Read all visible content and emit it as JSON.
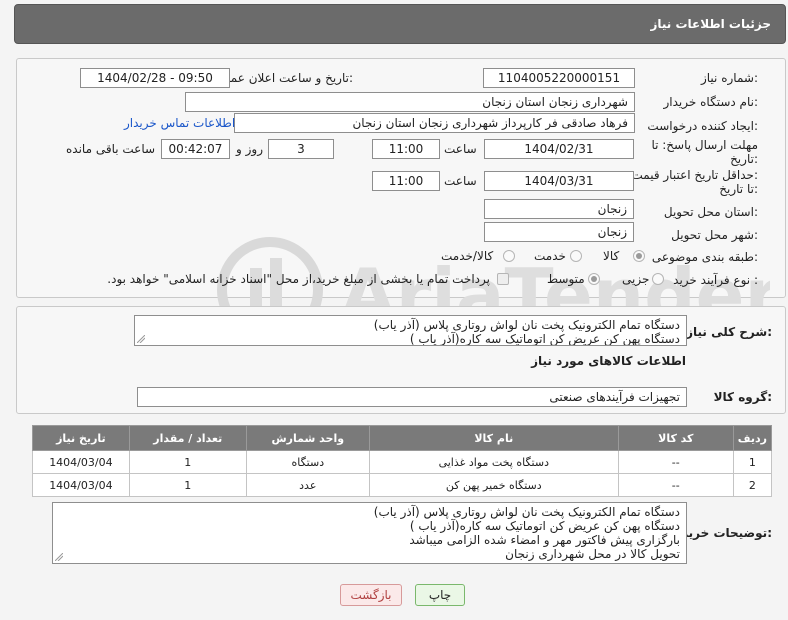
{
  "header": {
    "title": "جزئیات اطلاعات نیاز"
  },
  "form": {
    "need_number_label": "شماره نیاز:",
    "need_number": "1104005220000151",
    "announce_label": "تاریخ و ساعت اعلان عمومی:",
    "announce_value": "1404/02/28 - 09:50",
    "buyer_label": "نام دستگاه خریدار:",
    "buyer_value": "شهرداری زنجان استان زنجان",
    "creator_label": "ایجاد کننده درخواست:",
    "creator_value": "فرهاد صادقی فر کارپرداز شهرداری زنجان استان زنجان",
    "contact_link": "اطلاعات تماس خریدار",
    "deadline_label_1": "مهلت ارسال پاسخ: تا",
    "deadline_label_2": "تاریخ:",
    "deadline_date": "1404/02/31",
    "time_label": "ساعت",
    "deadline_time": "11:00",
    "days_value": "3",
    "days_label": "روز و",
    "remaining_time": "00:42:07",
    "remaining_label": "ساعت باقی مانده",
    "validity_label_1": "حداقل تاریخ اعتبار قیمت:",
    "validity_label_2": "تا تاریخ:",
    "validity_date": "1404/03/31",
    "validity_time": "11:00",
    "province_label": "استان محل تحویل:",
    "province_value": "زنجان",
    "city_label": "شهر محل تحویل:",
    "city_value": "زنجان",
    "category_label": "طبقه بندی موضوعی:",
    "category_options": [
      "کالا",
      "خدمت",
      "کالا/خدمت"
    ],
    "process_label": "نوع فرآیند خرید :",
    "process_options": [
      "جزیی",
      "متوسط"
    ],
    "payment_note": "پرداخت تمام یا بخشی از مبلغ خرید،از محل \"اسناد خزانه اسلامی\" خواهد بود."
  },
  "description": {
    "label": "شرح کلی نیاز:",
    "lines": [
      "دستگاه تمام الکترونیک پخت نان لواش روتاری پلاس (آذر یاب)",
      "دستگاه پهن کن عریض کن اتوماتیک سه کاره(آذر یاب )"
    ]
  },
  "goods": {
    "section_title": "اطلاعات کالاهای مورد نیاز",
    "group_label": "گروه کالا:",
    "group_value": "تجهیزات فرآیندهای صنعتی",
    "columns": [
      "ردیف",
      "کد کالا",
      "نام کالا",
      "واحد شمارش",
      "تعداد / مقدار",
      "تاریخ نیاز"
    ],
    "rows": [
      {
        "row": "1",
        "code": "--",
        "name": "دستگاه پخت مواد غذایی",
        "unit": "دستگاه",
        "qty": "1",
        "date": "1404/03/04"
      },
      {
        "row": "2",
        "code": "--",
        "name": "دستگاه خمیر پهن کن",
        "unit": "عدد",
        "qty": "1",
        "date": "1404/03/04"
      }
    ]
  },
  "buyer_notes": {
    "label": "توضیحات خریدار:",
    "lines": [
      "دستگاه تمام الکترونیک پخت نان لواش روتاری پلاس (آذر یاب)",
      "دستگاه پهن کن عریض کن اتوماتیک سه کاره(آذر یاب )",
      "بارگزاری پیش فاکتور مهر و امضاء شده الزامی میباشد",
      "تحویل کالا در محل شهرداری زنجان"
    ]
  },
  "buttons": {
    "print": "چاپ",
    "back": "بازگشت"
  },
  "colors": {
    "header_bg": "#6b6b6b",
    "link": "#1a56c9",
    "print_bg": "#eaf7e6",
    "back_bg": "#fbe9e9"
  }
}
